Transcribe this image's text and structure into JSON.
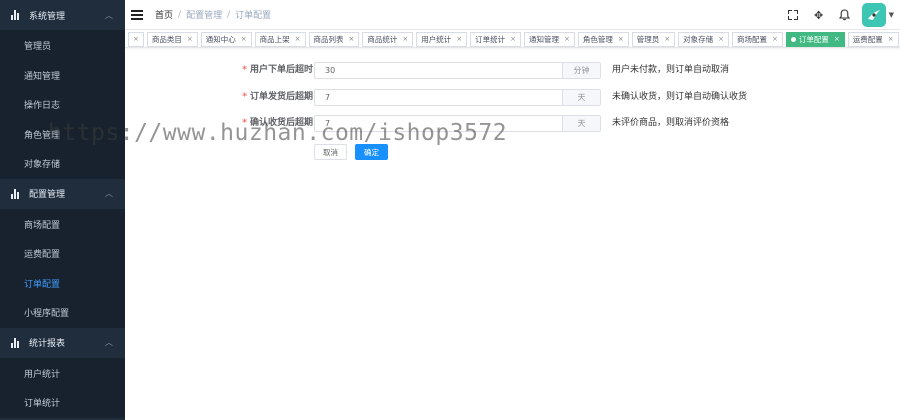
{
  "sidebar": {
    "groups": [
      {
        "title": "系统管理",
        "items": [
          "管理员",
          "通知管理",
          "操作日志",
          "角色管理",
          "对象存储"
        ]
      },
      {
        "title": "配置管理",
        "items": [
          "商场配置",
          "运费配置",
          "订单配置",
          "小程序配置"
        ]
      },
      {
        "title": "统计报表",
        "items": [
          "用户统计",
          "订单统计"
        ]
      }
    ],
    "active_item": "订单配置"
  },
  "header": {
    "breadcrumb": [
      "首页",
      "配置管理",
      "订单配置"
    ]
  },
  "tags": [
    {
      "label": "商品类目"
    },
    {
      "label": "通知中心"
    },
    {
      "label": "商品上架"
    },
    {
      "label": "商品列表"
    },
    {
      "label": "商品统计"
    },
    {
      "label": "用户统计"
    },
    {
      "label": "订单统计"
    },
    {
      "label": "通知管理"
    },
    {
      "label": "角色管理"
    },
    {
      "label": "管理员"
    },
    {
      "label": "对象存储"
    },
    {
      "label": "商场配置"
    },
    {
      "label": "订单配置",
      "active": true
    },
    {
      "label": "运费配置"
    }
  ],
  "form": {
    "fields": [
      {
        "label": "用户下单后超时",
        "value": "30",
        "unit": "分钟",
        "hint": "用户未付款，则订单自动取消"
      },
      {
        "label": "订单发货后超期",
        "value": "7",
        "unit": "天",
        "hint": "未确认收货，则订单自动确认收货"
      },
      {
        "label": "确认收货后超期",
        "value": "7",
        "unit": "天",
        "hint": "未评价商品，则取消评价资格"
      }
    ],
    "cancel_label": "取消",
    "confirm_label": "确定"
  },
  "watermark": "https://www.huzhan.com/ishop3572",
  "colors": {
    "sidebar_bg": "#1f2d3d",
    "active_link": "#409eff",
    "active_tag": "#42b983",
    "primary_button": "#1890ff"
  }
}
